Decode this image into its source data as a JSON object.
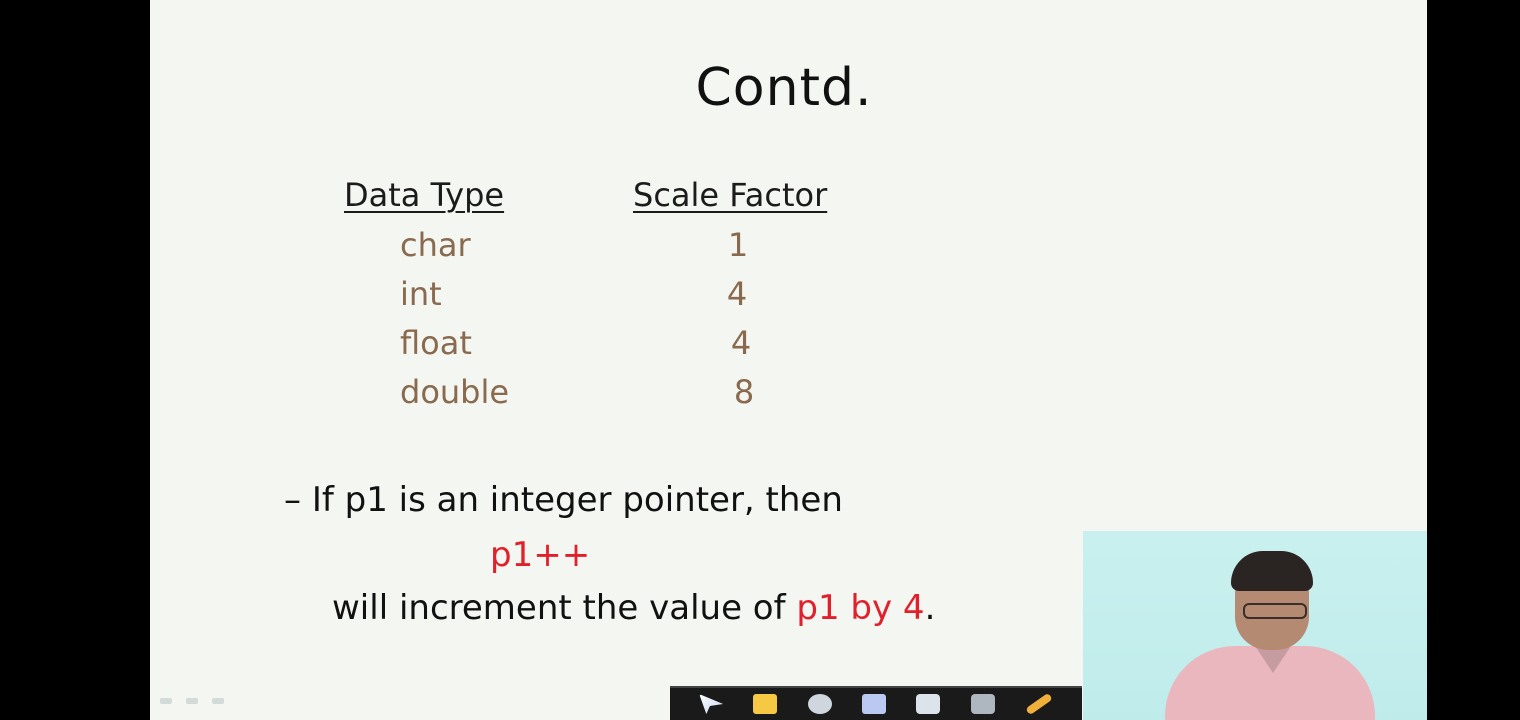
{
  "slide": {
    "title": "Contd.",
    "table": {
      "headers": [
        "Data Type",
        "Scale Factor"
      ],
      "rows": [
        {
          "type": "char",
          "scale": "1"
        },
        {
          "type": "int",
          "scale": "4"
        },
        {
          "type": "float",
          "scale": "4"
        },
        {
          "type": "double",
          "scale": "8"
        }
      ]
    },
    "bullet": {
      "dash": "–",
      "text": "If p1 is an integer pointer, then",
      "code": "p1++",
      "increment_prefix": "will increment the value of ",
      "increment_highlight": "p1 by 4",
      "increment_suffix": "."
    }
  },
  "colors": {
    "slide_background": "#f3f6f1",
    "table_values": "#8a6a4e",
    "highlight_red": "#e2202c",
    "presenter_background": "#c9f0ef"
  },
  "toolbar": {
    "icons": [
      "pointer-icon",
      "folder-icon",
      "gear-icon",
      "pen-icon",
      "eraser-icon",
      "whiteboard-icon",
      "marker-icon"
    ]
  }
}
